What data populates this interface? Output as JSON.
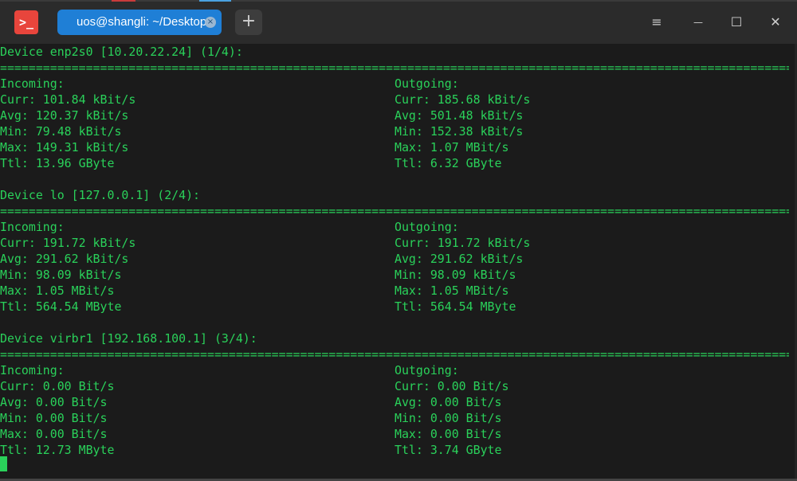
{
  "window": {
    "tab_title": "uos@shangli: ~/Desktop",
    "tab_close_glyph": "×",
    "new_tab_glyph": "+",
    "menu_glyph": "≡",
    "minimize_glyph": "—",
    "maximize_glyph": "☐",
    "close_glyph": "✕",
    "app_icon_glyph": ">_",
    "accent_color": "#1f7fd6",
    "app_icon_color": "#e8453c"
  },
  "terminal": {
    "text_color": "#2ad15a",
    "separator": "=================================================================================================================",
    "devices": [
      {
        "header": "Device enp2s0 [10.20.22.24] (1/4):",
        "incoming": {
          "label": "Incoming:",
          "curr": "Curr: 101.84 kBit/s",
          "avg": "Avg: 120.37 kBit/s",
          "min": "Min: 79.48 kBit/s",
          "max": "Max: 149.31 kBit/s",
          "ttl": "Ttl: 13.96 GByte"
        },
        "outgoing": {
          "label": "Outgoing:",
          "curr": "Curr: 185.68 kBit/s",
          "avg": "Avg: 501.48 kBit/s",
          "min": "Min: 152.38 kBit/s",
          "max": "Max: 1.07 MBit/s",
          "ttl": "Ttl: 6.32 GByte"
        }
      },
      {
        "header": "Device lo [127.0.0.1] (2/4):",
        "incoming": {
          "label": "Incoming:",
          "curr": "Curr: 191.72 kBit/s",
          "avg": "Avg: 291.62 kBit/s",
          "min": "Min: 98.09 kBit/s",
          "max": "Max: 1.05 MBit/s",
          "ttl": "Ttl: 564.54 MByte"
        },
        "outgoing": {
          "label": "Outgoing:",
          "curr": "Curr: 191.72 kBit/s",
          "avg": "Avg: 291.62 kBit/s",
          "min": "Min: 98.09 kBit/s",
          "max": "Max: 1.05 MBit/s",
          "ttl": "Ttl: 564.54 MByte"
        }
      },
      {
        "header": "Device virbr1 [192.168.100.1] (3/4):",
        "incoming": {
          "label": "Incoming:",
          "curr": "Curr: 0.00 Bit/s",
          "avg": "Avg: 0.00 Bit/s",
          "min": "Min: 0.00 Bit/s",
          "max": "Max: 0.00 Bit/s",
          "ttl": "Ttl: 12.73 MByte"
        },
        "outgoing": {
          "label": "Outgoing:",
          "curr": "Curr: 0.00 Bit/s",
          "avg": "Avg: 0.00 Bit/s",
          "min": "Min: 0.00 Bit/s",
          "max": "Max: 0.00 Bit/s",
          "ttl": "Ttl: 3.74 GByte"
        }
      }
    ]
  }
}
